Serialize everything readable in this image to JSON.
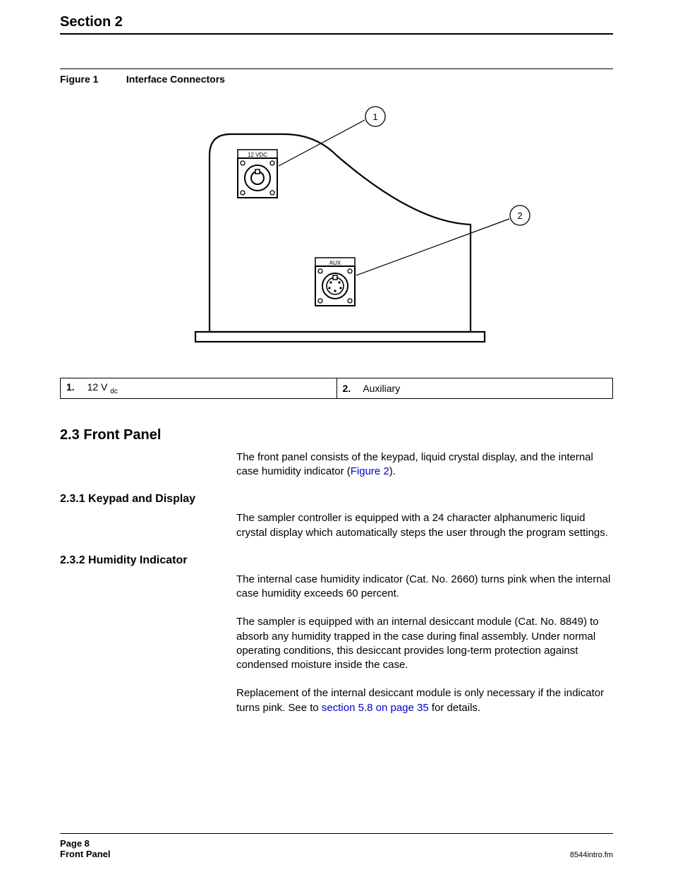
{
  "header": {
    "section": "Section 2"
  },
  "figure": {
    "label": "Figure 1",
    "title": "Interface Connectors",
    "callout1": "1",
    "callout2": "2",
    "conn1_label": "12 VDC",
    "conn2_label": "AUX"
  },
  "legend": {
    "item1_num": "1.",
    "item1_text_pre": "12 V ",
    "item1_text_sub": "dc",
    "item2_num": "2.",
    "item2_text": "Auxiliary"
  },
  "s23": {
    "heading": "2.3  Front Panel",
    "intro_pre": "The front panel consists of the keypad, liquid crystal display, and the internal case humidity indicator (",
    "intro_link": "Figure 2",
    "intro_post": ")."
  },
  "s231": {
    "heading": "2.3.1  Keypad and Display",
    "body": "The sampler controller is equipped with a 24 character alphanumeric liquid crystal display which automatically steps the user through the program settings."
  },
  "s232": {
    "heading": "2.3.2  Humidity Indicator",
    "p1": "The internal case humidity indicator (Cat. No. 2660) turns pink when the internal case humidity exceeds 60 percent.",
    "p2": "The sampler is equipped with an internal desiccant module (Cat. No. 8849) to absorb any humidity trapped in the case during final assembly. Under normal operating conditions, this desiccant provides long-term protection against condensed moisture inside the case.",
    "p3_pre": "Replacement of the internal desiccant module is only necessary if the indicator turns pink. See to ",
    "p3_link": "section 5.8 on page 35",
    "p3_post": " for details."
  },
  "footer": {
    "page": "Page 8",
    "title": "Front Panel",
    "file": "8544intro.fm"
  }
}
